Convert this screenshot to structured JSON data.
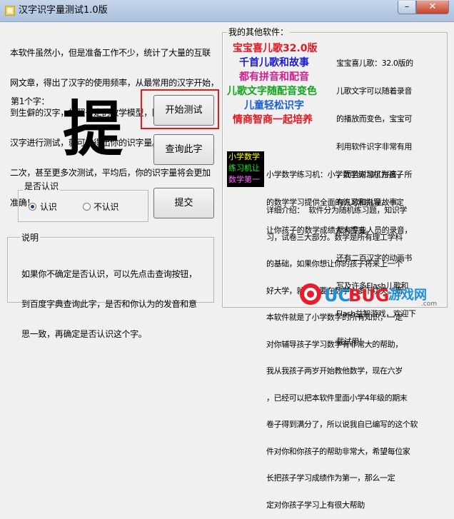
{
  "window": {
    "title": "汉字识字量测试1.0版",
    "minimize_glyph": "–",
    "close_glyph": "✕"
  },
  "intro": {
    "lines": [
      "本软件虽然小，但是准备工作不少，统计了大量的互联",
      "网文章，得出了汉字的使用频率，从最常用的汉字开始，",
      "到生僻的汉字，按照一定的数学模型，随机抽取91个",
      "汉字进行测试，就可以得出你的识字量。你可以进行第",
      "二次，甚至更多次测试，平均后，你的识字量将会更加",
      "准确！"
    ]
  },
  "test": {
    "counter_label": "第1个字：",
    "current_char": "提",
    "start_button": "开始测试",
    "query_button": "查询此字",
    "submit_button": "提交"
  },
  "recognize": {
    "legend": "是否认识",
    "yes_label": "认识",
    "no_label": "不认识",
    "selected": "认识"
  },
  "explain": {
    "legend": "说明",
    "lines": [
      "如果你不确定是否认识，可以先点击查询按钮，",
      "到百度字典查询此字，是否和你认为的发音和意",
      "思一致，再确定是否认识这个字。"
    ]
  },
  "other_software": {
    "legend": "我的其他软件：",
    "ad_lines": [
      {
        "text": "宝宝喜儿歌32.0版",
        "color": "#e8141e"
      },
      {
        "text": "千首儿歌和故事",
        "color": "#1a1ad6"
      },
      {
        "text": "都有拼音和配音",
        "color": "#d81a8c"
      },
      {
        "text": "儿歌文字随配音变色",
        "color": "#11a51d"
      },
      {
        "text": "儿童轻松识字",
        "color": "#1a5fd6"
      },
      {
        "text": "情商智商一起培养",
        "color": "#e8141e"
      }
    ],
    "ad_description": [
      "宝宝喜儿歌：32.0版的",
      "儿歌文字可以随着录音",
      "的播放而变色，宝宝可",
      "利用软件识字非常有用",
      "，而且对加了拼音，所",
      "有儿歌和儿童故事",
      "都有专业人员的录音，",
      "还有二百汉字的动画书",
      "写及许多Flash儿歌和",
      "Flash益智游戏，欢迎下",
      "载试用！"
    ],
    "math_logo_lines": [
      "小学数学",
      "练习机让",
      "数学第一"
    ],
    "math_logo_colors": [
      "#ffff00",
      "#00ff00",
      "#ff66ff"
    ],
    "math_summary": [
      "小学数学练习机：小学数学练习机为孩子",
      "的数学学习提供全面的练习和指导，一定",
      "让你孩子的数学成绩大大提高。"
    ],
    "detail": [
      "详细介绍：  软件分为随机练习题，知识学",
      "习，试卷三大部分。数学是所有理工学科",
      "的基础，如果你想让你的孩子将来上一个",
      "好大学，就一定要在数学上多下功夫。而",
      "本软件就是了小学数学的所有知识，一定",
      "对你辅导孩子学习数学有非常大的帮助，",
      "我从我孩子两岁开始教他数学，现在六岁",
      "，已经可以把本软件里面小学4年级的期末",
      "卷子得到满分了，所以说我自已编写的这个软",
      "件对你和你孩子的帮助非常大，希望每位家",
      "长把孩子学习成绩作为第一，那么一定",
      "定对你孩子学习上有很大帮助"
    ]
  },
  "watermark": {
    "brand_uc": "UC",
    "brand_bug": "BUG",
    "site_text": "游戏网",
    "domain": ".com"
  }
}
